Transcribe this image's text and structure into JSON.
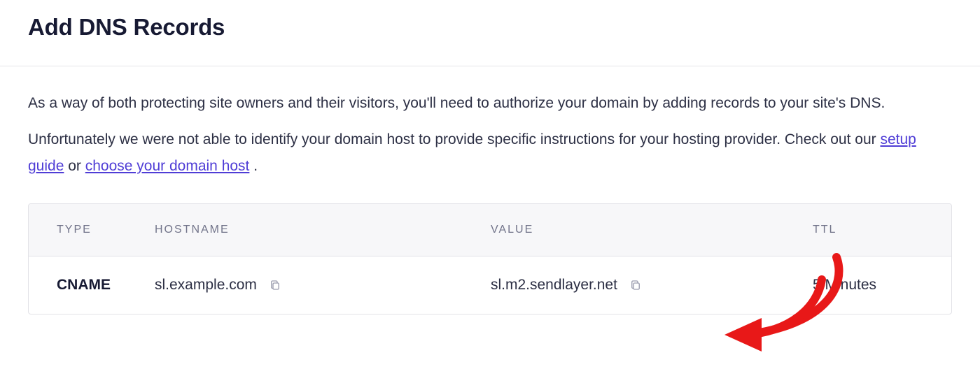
{
  "header": {
    "title": "Add DNS Records"
  },
  "description": {
    "p1": "As a way of both protecting site owners and their visitors, you'll need to authorize your domain by adding records to your site's DNS.",
    "p2_before": "Unfortunately we were not able to identify your domain host to provide specific instructions for your hosting provider. Check out our ",
    "link_setup": "setup guide",
    "p2_between": " or ",
    "link_choose": "choose your domain host",
    "p2_after_period": "."
  },
  "table": {
    "headers": {
      "type": "TYPE",
      "hostname": "HOSTNAME",
      "value": "VALUE",
      "ttl": "TTL"
    },
    "rows": [
      {
        "type": "CNAME",
        "hostname": "sl.example.com",
        "value": "sl.m2.sendlayer.net",
        "ttl": "5 Minutes"
      }
    ]
  }
}
